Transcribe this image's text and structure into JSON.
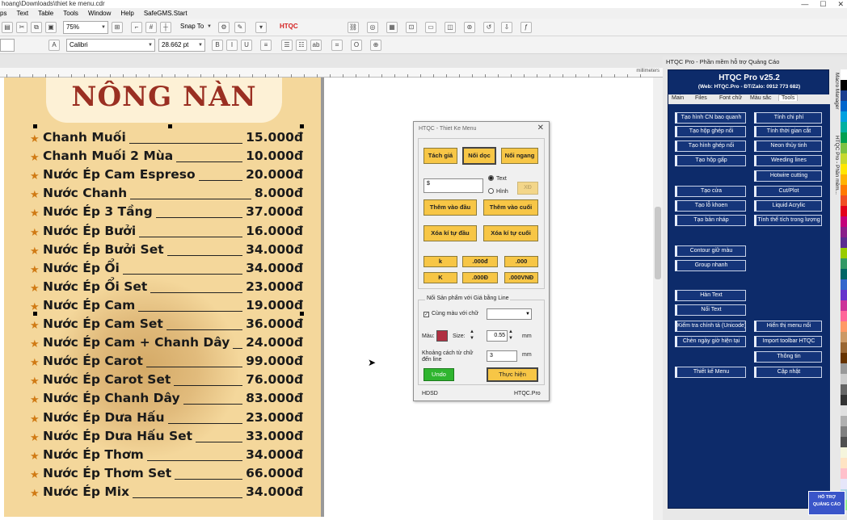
{
  "window": {
    "title": "hoang\\Downloads\\thiet ke menu.cdr",
    "controls": [
      "—",
      "☐",
      "✕"
    ]
  },
  "menubar": [
    "ps",
    "Text",
    "Table",
    "Tools",
    "Window",
    "Help",
    "SafeGMS.Start"
  ],
  "toolbar1": {
    "zoom": "75%",
    "snap_to": "Snap To",
    "htqc_label": "HTQC"
  },
  "toolbar2": {
    "font": "Calibri",
    "font_size": "28.662 pt"
  },
  "ruler": {
    "unit": "millimeters"
  },
  "poster": {
    "title": "NÔNG NÀN",
    "items": [
      {
        "name": "Chanh Muối",
        "price": "15.000đ"
      },
      {
        "name": "Chanh Muối 2 Mùa",
        "price": "10.000đ"
      },
      {
        "name": "Nước Ép Cam Espreso",
        "price": "20.000đ"
      },
      {
        "name": "Nước Chanh",
        "price": "8.000đ"
      },
      {
        "name": "Nước Ép 3 Tầng",
        "price": "37.000đ"
      },
      {
        "name": "Nước Ép Bưởi",
        "price": "16.000đ"
      },
      {
        "name": "Nước Ép Bưởi Set",
        "price": "34.000đ"
      },
      {
        "name": "Nước Ép Ổi",
        "price": "34.000đ"
      },
      {
        "name": "Nước Ép Ổi Set",
        "price": "23.000đ"
      },
      {
        "name": "Nước Ép Cam",
        "price": "19.000đ"
      },
      {
        "name": "Nước Ép Cam Set",
        "price": "36.000đ"
      },
      {
        "name": "Nước Ép Cam + Chanh Dây",
        "price": "24.000đ"
      },
      {
        "name": "Nước Ép Carot",
        "price": "99.000đ"
      },
      {
        "name": "Nước Ép Carot Set",
        "price": "76.000đ"
      },
      {
        "name": "Nước Ép Chanh Dây",
        "price": "83.000đ"
      },
      {
        "name": "Nước Ép Dưa Hấu",
        "price": "23.000đ"
      },
      {
        "name": "Nước Ép Dưa Hấu Set",
        "price": "33.000đ"
      },
      {
        "name": "Nước Ép Thơm",
        "price": "34.000đ"
      },
      {
        "name": "Nước Ép Thơm Set",
        "price": "66.000đ"
      },
      {
        "name": "Nước Ép Mix",
        "price": "34.000đ"
      }
    ]
  },
  "dialog": {
    "title": "HTQC - Thiet Ke Menu",
    "close": "✕",
    "btn_tach_gia": "Tách giá",
    "btn_noi_doc": "Nối dọc",
    "btn_noi_ngang": "Nối ngang",
    "text_value": "$",
    "radio_text": "Text",
    "radio_hinh": "Hình",
    "btn_xd": "XĐ",
    "btn_them_dau": "Thêm vào đầu",
    "btn_them_cuoi": "Thêm vào cuối",
    "btn_xoa_dau": "Xóa kí tự đầu",
    "btn_xoa_cuoi": "Xóa kí tự cuối",
    "fmt_buttons": [
      "k",
      ".000đ",
      ".000",
      "K",
      ".000Đ",
      ".000VNĐ"
    ],
    "group_label": "Nối Sản phẩm với Giá bằng Line",
    "chk_cung_mau": "Cùng màu với chữ",
    "mau_label": "Màu:",
    "size_label": "Size:",
    "size_value": "0.55",
    "unit_mm": "mm",
    "khoang_cach_label": "Khoảng cách từ chữ đến line",
    "khoang_cach_value": "3",
    "unit_mm2": "mm",
    "btn_undo": "Undo",
    "btn_thuc_hien": "Thực hiện",
    "footer_left": "HDSD",
    "footer_right": "HTQC.Pro",
    "swatch_color": "#b03042"
  },
  "panel": {
    "header": "HTQC Pro - Phần mềm hỗ trợ Quảng Cáo",
    "title": "HTQC Pro v25.2",
    "subtitle": "(Web: HTQC.Pro - ĐT/Zalo: 0912 773 682)",
    "tabs": [
      "Main",
      "Files",
      "Font chữ",
      "Màu sắc",
      "Tools"
    ],
    "active_tab": "Tools",
    "left_buttons": [
      "Tạo hình CN bao quanh",
      "Tạo hộp ghép nối",
      "Tạo hình ghép nối",
      "Tạo hộp gấp",
      "Tạo cửa",
      "Tạo lỗ khoen",
      "Tạo bản nháp",
      "Contour giữ màu",
      "Group nhanh",
      "Hàn Text",
      "Nối Text",
      "Kiểm tra chính tả (Unicode)",
      "Chèn ngày giờ hiện tại",
      "Thiết kế Menu"
    ],
    "right_buttons": [
      "Tính chi phí",
      "Tính thời gian cắt",
      "Neon thủy tinh",
      "Weeding lines",
      "Hotwire cutting",
      "Cut/Plot",
      "Liquid Acrylic",
      "Tính thể tích trong lượng",
      "Hiển thị menu nổi",
      "Import toolbar HTQC",
      "Thông tin",
      "Cập nhật"
    ],
    "docker_tabs": [
      "Macro Manager",
      "HTQC Pro - Phần mềm..."
    ],
    "badge_line1": "HỖ TRỢ",
    "badge_line2": "QUẢNG CÁO"
  },
  "colors": {
    "panel_bg": "#0d2b6a",
    "accent_yellow": "#f7c646",
    "poster_bg": "#f4d79b",
    "title_red": "#9a2f22"
  }
}
